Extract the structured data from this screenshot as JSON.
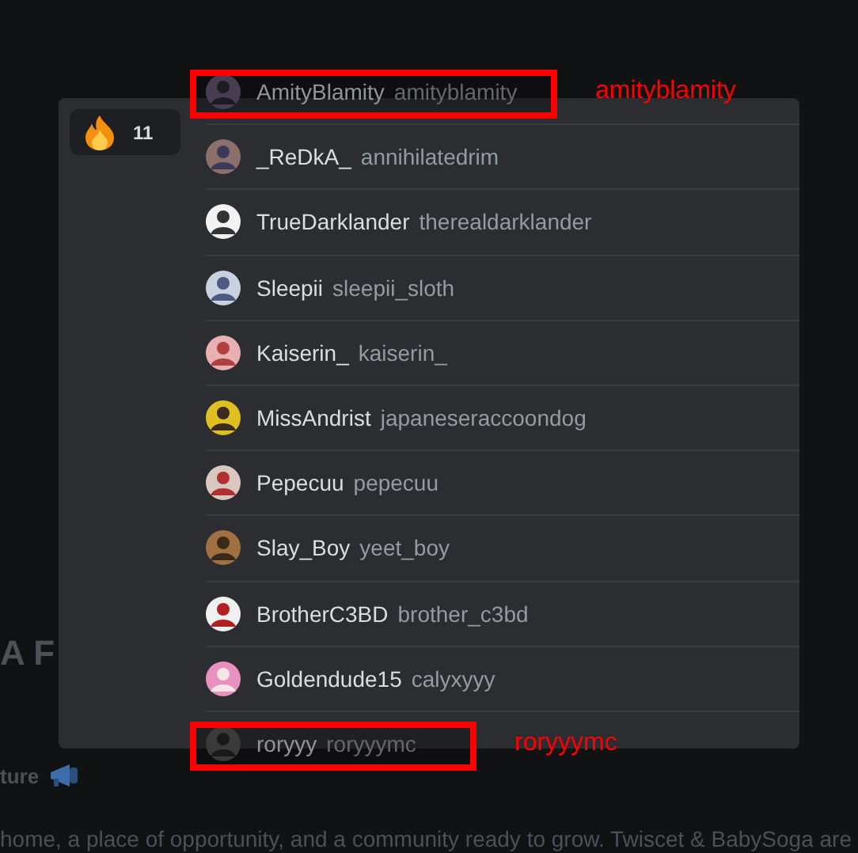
{
  "background": {
    "heading": "A F",
    "subheading": "ture",
    "paragraph": "home, a place of opportunity, and a community ready to grow. Twiscet & BabySoga are"
  },
  "reaction": {
    "count": "11",
    "selected": true
  },
  "users": [
    {
      "display_name": "AmityBlamity",
      "username": "amityblamity",
      "annotation": "amityblamity"
    },
    {
      "display_name": "_ReDkA_",
      "username": "annihilatedrim"
    },
    {
      "display_name": "TrueDarklander",
      "username": "therealdarklander"
    },
    {
      "display_name": "Sleepii",
      "username": "sleepii_sloth"
    },
    {
      "display_name": "Kaiserin_",
      "username": "kaiserin_"
    },
    {
      "display_name": "MissAndrist",
      "username": "japaneseraccoondog"
    },
    {
      "display_name": "Pepecuu",
      "username": "pepecuu"
    },
    {
      "display_name": "Slay_Boy",
      "username": "yeet_boy"
    },
    {
      "display_name": "BrotherC3BD",
      "username": "brother_c3bd"
    },
    {
      "display_name": "Goldendude15",
      "username": "calyxyyy"
    },
    {
      "display_name": "roryyy",
      "username": "roryyymc",
      "annotation": "roryyymc"
    }
  ]
}
